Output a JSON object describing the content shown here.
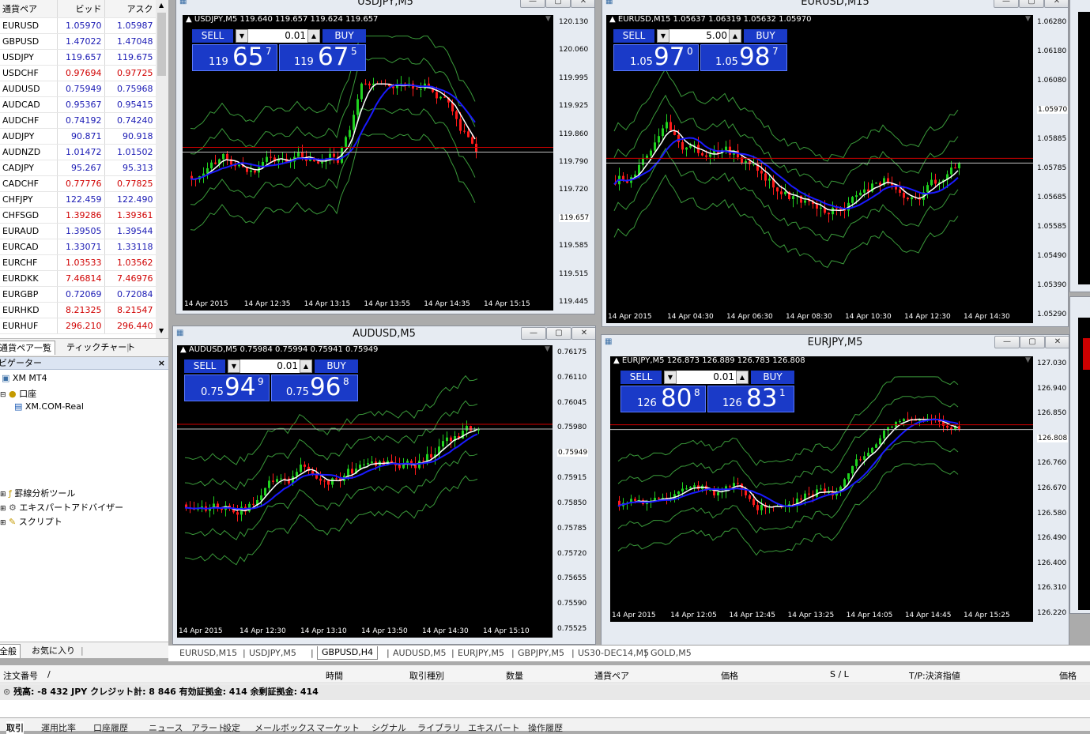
{
  "market_watch": {
    "col_symbol": "通貨ペア",
    "col_bid": "ビッド",
    "col_ask": "アスク",
    "rows": [
      {
        "s": "EURUSD",
        "b": "1.05970",
        "a": "1.05987",
        "c": "up"
      },
      {
        "s": "GBPUSD",
        "b": "1.47022",
        "a": "1.47048",
        "c": "up"
      },
      {
        "s": "USDJPY",
        "b": "119.657",
        "a": "119.675",
        "c": "up"
      },
      {
        "s": "USDCHF",
        "b": "0.97694",
        "a": "0.97725",
        "c": "dn"
      },
      {
        "s": "AUDUSD",
        "b": "0.75949",
        "a": "0.75968",
        "c": "up"
      },
      {
        "s": "AUDCAD",
        "b": "0.95367",
        "a": "0.95415",
        "c": "up"
      },
      {
        "s": "AUDCHF",
        "b": "0.74192",
        "a": "0.74240",
        "c": "up"
      },
      {
        "s": "AUDJPY",
        "b": "90.871",
        "a": "90.918",
        "c": "up"
      },
      {
        "s": "AUDNZD",
        "b": "1.01472",
        "a": "1.01502",
        "c": "up"
      },
      {
        "s": "CADJPY",
        "b": "95.267",
        "a": "95.313",
        "c": "up"
      },
      {
        "s": "CADCHF",
        "b": "0.77776",
        "a": "0.77825",
        "c": "dn"
      },
      {
        "s": "CHFJPY",
        "b": "122.459",
        "a": "122.490",
        "c": "up"
      },
      {
        "s": "CHFSGD",
        "b": "1.39286",
        "a": "1.39361",
        "c": "dn"
      },
      {
        "s": "EURAUD",
        "b": "1.39505",
        "a": "1.39544",
        "c": "up"
      },
      {
        "s": "EURCAD",
        "b": "1.33071",
        "a": "1.33118",
        "c": "up"
      },
      {
        "s": "EURCHF",
        "b": "1.03533",
        "a": "1.03562",
        "c": "dn"
      },
      {
        "s": "EURDKK",
        "b": "7.46814",
        "a": "7.46976",
        "c": "dn"
      },
      {
        "s": "EURGBP",
        "b": "0.72069",
        "a": "0.72084",
        "c": "up"
      },
      {
        "s": "EURHKD",
        "b": "8.21325",
        "a": "8.21547",
        "c": "dn"
      },
      {
        "s": "EURHUF",
        "b": "296.210",
        "a": "296.440",
        "c": "dn"
      }
    ],
    "tab_pairs": "通貨ペア一覧",
    "tab_tick": "ティックチャート"
  },
  "navigator": {
    "title": "ビゲーター",
    "items": [
      "XM MT4",
      "口座",
      "XM.COM-Real",
      "罫線分析ツール",
      "エキスパートアドバイザー",
      "スクリプト"
    ],
    "tab_all": "全般",
    "tab_fav": "お気に入り"
  },
  "charts": [
    {
      "title": "USDJPY,M5",
      "header": "USDJPY,M5  119.640 119.657 119.624 119.657",
      "sell": "SELL",
      "buy": "BUY",
      "lot": "0.01",
      "bid_small": "119",
      "bid_big": "65",
      "bid_pip": "7",
      "ask_small": "119",
      "ask_big": "67",
      "ask_pip": "5",
      "yticks": [
        "120.130",
        "120.060",
        "119.995",
        "119.925",
        "119.860",
        "119.790",
        "119.720",
        "119.657",
        "119.585",
        "119.515",
        "119.445"
      ],
      "xticks": [
        "14 Apr 2015",
        "14 Apr 12:35",
        "14 Apr 13:15",
        "14 Apr 13:55",
        "14 Apr 14:35",
        "14 Apr 15:15"
      ],
      "current": "119.657"
    },
    {
      "title": "EURUSD,M15",
      "header": "EURUSD,M15  1.05637 1.06319 1.05632 1.05970",
      "sell": "SELL",
      "buy": "BUY",
      "lot": "5.00",
      "bid_small": "1.05",
      "bid_big": "97",
      "bid_pip": "0",
      "ask_small": "1.05",
      "ask_big": "98",
      "ask_pip": "7",
      "yticks": [
        "1.06280",
        "1.06180",
        "1.06080",
        "1.05970",
        "1.05885",
        "1.05785",
        "1.05685",
        "1.05585",
        "1.05490",
        "1.05390",
        "1.05290"
      ],
      "xticks": [
        "14 Apr 2015",
        "14 Apr 04:30",
        "14 Apr 06:30",
        "14 Apr 08:30",
        "14 Apr 10:30",
        "14 Apr 12:30",
        "14 Apr 14:30"
      ],
      "current": "1.05970"
    },
    {
      "title": "AUDUSD,M5",
      "header": "AUDUSD,M5  0.75984 0.75994 0.75941 0.75949",
      "sell": "SELL",
      "buy": "BUY",
      "lot": "0.01",
      "bid_small": "0.75",
      "bid_big": "94",
      "bid_pip": "9",
      "ask_small": "0.75",
      "ask_big": "96",
      "ask_pip": "8",
      "yticks": [
        "0.76175",
        "0.76110",
        "0.76045",
        "0.75980",
        "0.75949",
        "0.75915",
        "0.75850",
        "0.75785",
        "0.75720",
        "0.75655",
        "0.75590",
        "0.75525"
      ],
      "xticks": [
        "14 Apr 2015",
        "14 Apr 12:30",
        "14 Apr 13:10",
        "14 Apr 13:50",
        "14 Apr 14:30",
        "14 Apr 15:10"
      ],
      "current": "0.75949"
    },
    {
      "title": "EURJPY,M5",
      "header": "EURJPY,M5  126.873 126.889 126.783 126.808",
      "sell": "SELL",
      "buy": "BUY",
      "lot": "0.01",
      "bid_small": "126",
      "bid_big": "80",
      "bid_pip": "8",
      "ask_small": "126",
      "ask_big": "83",
      "ask_pip": "1",
      "yticks": [
        "127.030",
        "126.940",
        "126.850",
        "126.808",
        "126.760",
        "126.670",
        "126.580",
        "126.490",
        "126.400",
        "126.310",
        "126.220"
      ],
      "xticks": [
        "14 Apr 2015",
        "14 Apr 12:05",
        "14 Apr 12:45",
        "14 Apr 13:25",
        "14 Apr 14:05",
        "14 Apr 14:45",
        "14 Apr 15:25"
      ],
      "current": "126.808"
    }
  ],
  "chart_tabs": [
    "EURUSD,M15",
    "USDJPY,M5",
    "GBPUSD,H4",
    "AUDUSD,M5",
    "EURJPY,M5",
    "GBPJPY,M5",
    "US30-DEC14,M5",
    "GOLD,M5"
  ],
  "terminal": {
    "headers": [
      "注文番号",
      "/",
      "時間",
      "取引種別",
      "数量",
      "通貨ペア",
      "価格",
      "S / L",
      "T/P:決済指値",
      "価格"
    ],
    "balance": "残高: -8 432 JPY  クレジット計: 8 846  有効証拠金: 414  余剰証拠金: 414",
    "tabs": [
      "取引",
      "運用比率",
      "口座履歴",
      "ニュース",
      "アラート",
      "設定",
      "メールボックス",
      "マーケット",
      "シグナル",
      "ライブラリ",
      "エキスパート",
      "操作履歴"
    ]
  },
  "colors": {
    "bull": "#1fd11f",
    "bear": "#ff1a1a",
    "panel": "#1a3ac8",
    "bands": "#3a9a3a",
    "ma_fast": "#ffffff",
    "ma_slow": "#1a1aff"
  }
}
